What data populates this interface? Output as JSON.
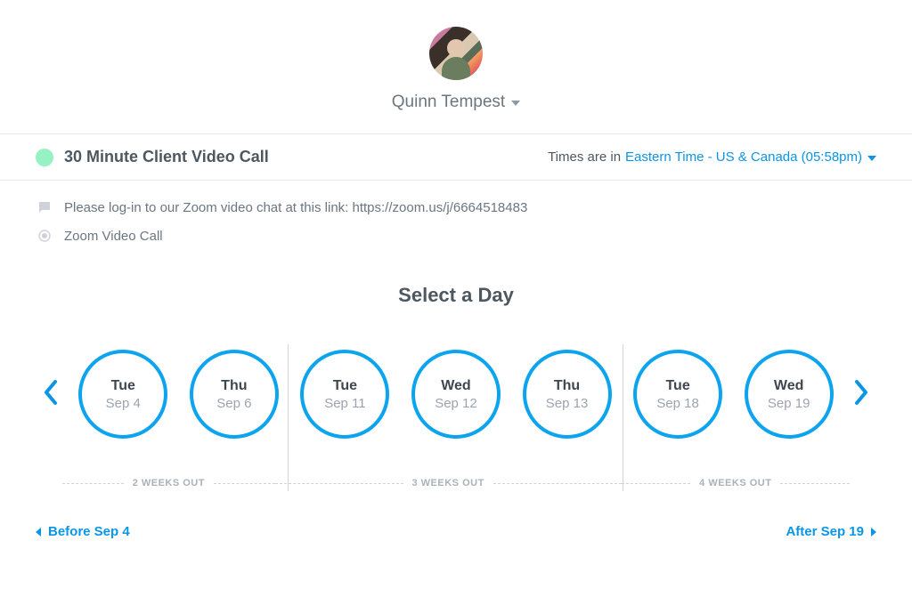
{
  "profile": {
    "name": "Quinn Tempest"
  },
  "header": {
    "title": "30 Minute Client Video Call",
    "timezone_prefix": "Times are in",
    "timezone": "Eastern Time - US & Canada (05:58pm)"
  },
  "info": {
    "instruction": "Please log-in to our Zoom video chat at this link: https://zoom.us/j/6664518483",
    "location": "Zoom Video Call"
  },
  "section_title": "Select a Day",
  "days": [
    {
      "day": "Tue",
      "date": "Sep 4"
    },
    {
      "day": "Thu",
      "date": "Sep 6"
    },
    {
      "day": "Tue",
      "date": "Sep 11"
    },
    {
      "day": "Wed",
      "date": "Sep 12"
    },
    {
      "day": "Thu",
      "date": "Sep 13"
    },
    {
      "day": "Tue",
      "date": "Sep 18"
    },
    {
      "day": "Wed",
      "date": "Sep 19"
    }
  ],
  "weeks_out": {
    "label1": "2 WEEKS OUT",
    "label2": "3 WEEKS OUT",
    "label3": "4 WEEKS OUT"
  },
  "footer": {
    "before": "Before Sep 4",
    "after": "After Sep 19"
  }
}
